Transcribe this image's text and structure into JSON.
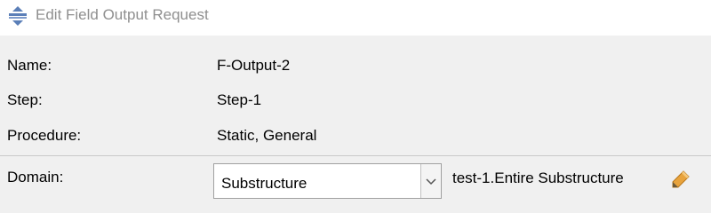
{
  "window": {
    "title": "Edit Field Output Request",
    "icon": "output-request-icon"
  },
  "fields": {
    "name": {
      "label": "Name:",
      "value": "F-Output-2"
    },
    "step": {
      "label": "Step:",
      "value": "Step-1"
    },
    "procedure": {
      "label": "Procedure:",
      "value": "Static, General"
    }
  },
  "domain": {
    "label": "Domain:",
    "selected": "Substructure",
    "value": "test-1.Entire Substructure",
    "edit_icon": "pencil-icon"
  },
  "colors": {
    "title_text": "#8f8f8f",
    "icon_blue": "#5b7fb8",
    "pencil_orange": "#e8a33c"
  }
}
